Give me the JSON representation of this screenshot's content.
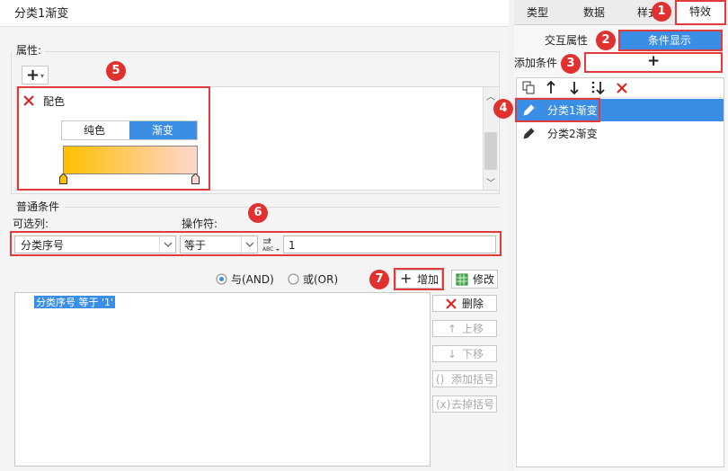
{
  "dialog": {
    "title": "分类1渐变"
  },
  "properties": {
    "group_label": "属性:",
    "add_symbol": "+",
    "item_label": "配色",
    "color_tabs": {
      "solid": "纯色",
      "gradient": "渐变"
    },
    "gradient_colors": {
      "start": "#ffc000",
      "end": "#ffd6d0"
    }
  },
  "condition": {
    "group_label": "普通条件",
    "column_label": "可选列:",
    "operator_label": "操作符:",
    "column_value": "分类序号",
    "operator_value": "等于",
    "value": "1",
    "logic": {
      "and_label": "与(AND)",
      "or_label": "或(OR)",
      "selected": "and"
    },
    "add_button": "增加",
    "modify_button": "修改",
    "list": [
      "分类序号 等于 '1'"
    ],
    "side_buttons": {
      "delete": "删除",
      "move_up": "上移",
      "move_down": "下移",
      "add_bracket": "添加括号",
      "remove_bracket": "去掉括号"
    }
  },
  "right_panel": {
    "tabs": [
      "类型",
      "数据",
      "样式",
      "特效"
    ],
    "active_tab": "特效",
    "interaction_label": "交互属性",
    "condition_display_button": "条件显示",
    "add_condition_label": "添加条件",
    "add_condition_symbol": "+",
    "conditions": [
      {
        "name": "分类1渐变",
        "selected": true
      },
      {
        "name": "分类2渐变",
        "selected": false
      }
    ]
  },
  "annotations": [
    "1",
    "2",
    "3",
    "4",
    "5",
    "6",
    "7"
  ],
  "colors": {
    "accent": "#3a8ee6",
    "annotation": "#e0312f",
    "delete": "#e02020",
    "scroll_selected": "#3a8ee6"
  }
}
